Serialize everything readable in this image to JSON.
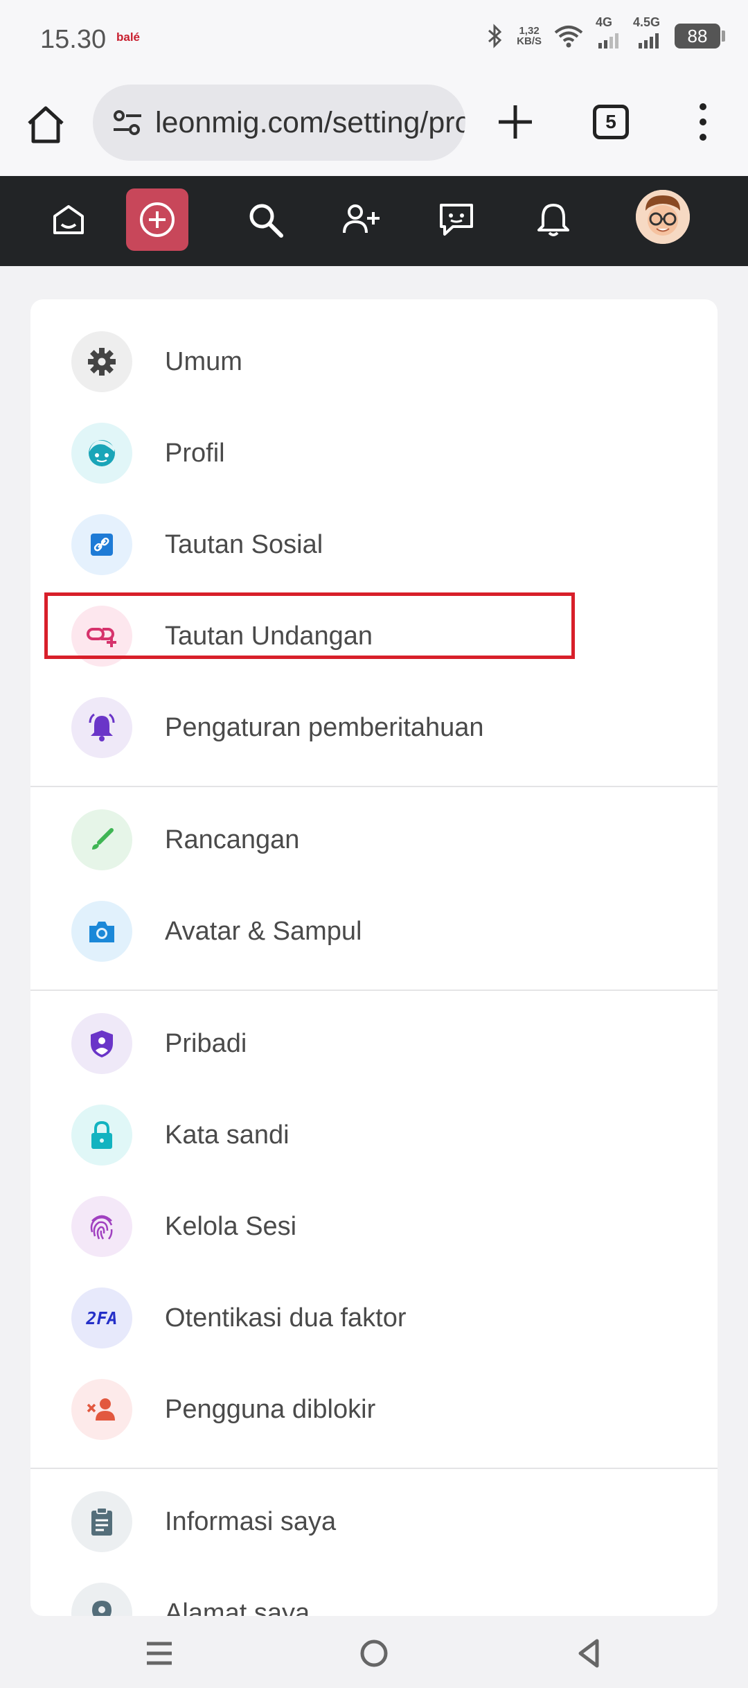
{
  "status": {
    "time": "15.30",
    "app_badge": "balé",
    "speed_value": "1,32",
    "speed_unit": "KB/S",
    "net1": "4G",
    "net2": "4.5G",
    "battery": "88"
  },
  "browser": {
    "url": "leonmig.com/setting/profile",
    "tab_count": "5"
  },
  "nav": {
    "items": [
      "home-icon",
      "create-icon",
      "search-icon",
      "add-friend-icon",
      "messages-icon",
      "notifications-icon",
      "avatar"
    ]
  },
  "colors": {
    "nav_bg": "#222426",
    "create_bg": "#c8475a",
    "highlight": "#d81f2a"
  },
  "settings": {
    "items": [
      {
        "label": "Umum",
        "icon": "gear-icon"
      },
      {
        "label": "Profil",
        "icon": "face-icon"
      },
      {
        "label": "Tautan Sosial",
        "icon": "link-icon"
      },
      {
        "label": "Tautan Undangan",
        "icon": "link-add-icon"
      },
      {
        "label": "Pengaturan pemberitahuan",
        "icon": "bell-icon"
      },
      {
        "label": "Rancangan",
        "icon": "brush-icon"
      },
      {
        "label": "Avatar & Sampul",
        "icon": "camera-icon"
      },
      {
        "label": "Pribadi",
        "icon": "shield-icon"
      },
      {
        "label": "Kata sandi",
        "icon": "lock-icon"
      },
      {
        "label": "Kelola Sesi",
        "icon": "fingerprint-icon"
      },
      {
        "label": "Otentikasi dua faktor",
        "icon": "2fa-icon",
        "icon_text": "2FA"
      },
      {
        "label": "Pengguna diblokir",
        "icon": "blocked-user-icon"
      },
      {
        "label": "Informasi saya",
        "icon": "clipboard-icon"
      },
      {
        "label": "Alamat saya",
        "icon": "location-icon"
      }
    ]
  }
}
